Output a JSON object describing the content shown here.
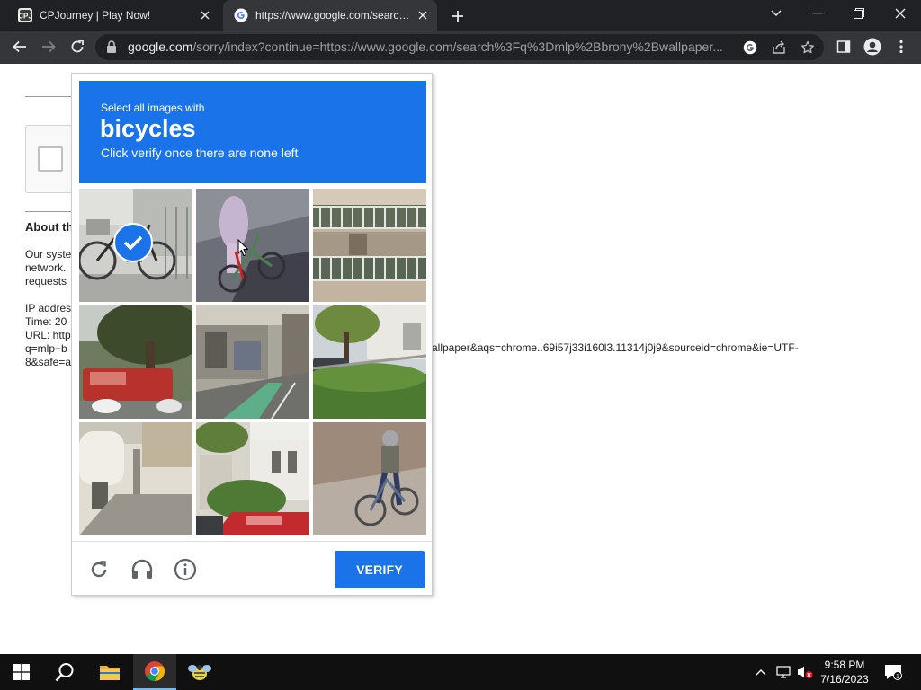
{
  "browser": {
    "tabs": [
      {
        "title": "CPJourney | Play Now!",
        "active": false
      },
      {
        "title": "https://www.google.com/search?q=mlp+brony+wallpaper",
        "active": true
      }
    ],
    "omnibox": {
      "host": "google.com",
      "path": "/sorry/index?continue=https://www.google.com/search%3Fq%3Dmlp%2Bbrony%2Bwallpaper..."
    }
  },
  "page": {
    "about_heading": "About th",
    "lines": [
      "Our syste",
      "network.",
      "requests",
      "IP addres",
      "Time: 20",
      "URL: http",
      "q=mlp+b",
      "8&safe=a"
    ],
    "url_tail": "allpaper&aqs=chrome..69i57j33i160l3.11314j0j9&sourceid=chrome&ie=UTF-"
  },
  "captcha": {
    "instruction_line1": "Select all images with",
    "target": "bicycles",
    "instruction_line2": "Click verify once there are none left",
    "tiles": [
      {
        "content": "bicycle parked at rack",
        "selected": true
      },
      {
        "content": "person walking bicycle",
        "selected": false
      },
      {
        "content": "apartment balconies",
        "selected": false
      },
      {
        "content": "tree and red car",
        "selected": false
      },
      {
        "content": "narrow street",
        "selected": false
      },
      {
        "content": "street with hedges",
        "selected": false
      },
      {
        "content": "white building walkway",
        "selected": false
      },
      {
        "content": "red car and plants",
        "selected": false
      },
      {
        "content": "cyclist on road",
        "selected": false
      }
    ],
    "verify_label": "VERIFY"
  },
  "taskbar": {
    "time": "9:58 PM",
    "date": "7/16/2023",
    "notification_count": "1"
  },
  "colors": {
    "accent": "#1a73e8",
    "chrome_dark": "#202124",
    "chrome_toolbar": "#35363a",
    "taskbar": "#101010"
  }
}
